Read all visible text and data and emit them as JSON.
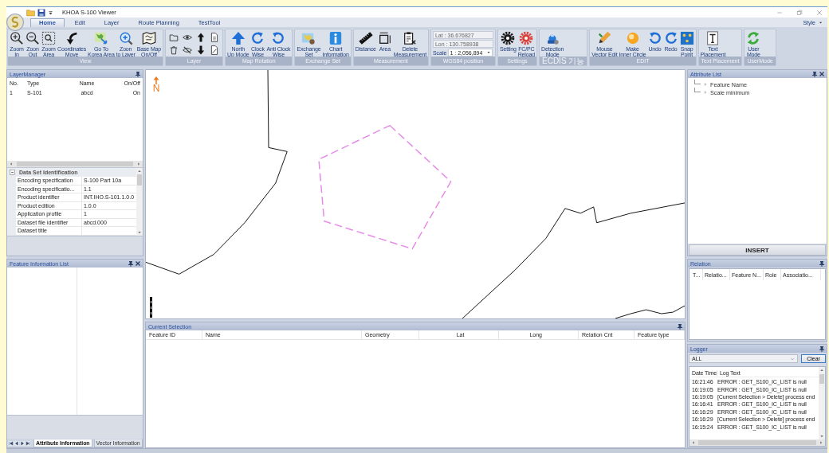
{
  "window": {
    "title": "KHOA S-100 Viewer",
    "style_menu": "Style"
  },
  "tabs": [
    {
      "label": "Home",
      "selected": true
    },
    {
      "label": "Edit",
      "selected": false
    },
    {
      "label": "Layer",
      "selected": false
    },
    {
      "label": "Route Planning",
      "selected": false
    },
    {
      "label": "TestTool",
      "selected": false
    }
  ],
  "ribbon": [
    {
      "label": "View",
      "kind": "buttons",
      "buttons": [
        "Zoom\nIn",
        "Zoon\nOut",
        "Zoom\nArea",
        "Coordinates\nMove",
        "Go To\nKorea Area",
        "Zoon\nto Layer",
        "Base Map\nOn/Off"
      ]
    },
    {
      "label": "Layer",
      "kind": "small_icons"
    },
    {
      "label": "Map Rotation",
      "kind": "buttons",
      "buttons": [
        "North\nUp Mode",
        "Clock\nWise",
        "Anti Clock\nWise"
      ]
    },
    {
      "label": "Exchange Set",
      "kind": "buttons",
      "buttons": [
        "Exchange\nSet",
        "Chart\nInformation"
      ]
    },
    {
      "label": "Measurement",
      "kind": "buttons",
      "buttons": [
        "Distance",
        "Area",
        "Delete\nMeasurement"
      ]
    },
    {
      "label": "WGS84 position",
      "kind": "position",
      "lat": "Lat : 36.676827",
      "lon": "Lon : 130.758938",
      "scale_label": "Scale",
      "scale": "1 : 2,056,894"
    },
    {
      "label": "Settings",
      "kind": "buttons",
      "buttons": [
        "Setting",
        "FC/PC\nReload"
      ]
    },
    {
      "label": "ECDIS 기능",
      "kind": "buttons",
      "buttons": [
        "Detection\nMode"
      ]
    },
    {
      "label": "EDIT",
      "kind": "buttons",
      "buttons": [
        "Mouse\nVector Edit",
        "Make\nInner Circle",
        "Undo",
        "Redo",
        "Snap\nPoint"
      ]
    },
    {
      "label": "Text Placement",
      "kind": "buttons",
      "buttons": [
        "Text\nPlacement"
      ]
    },
    {
      "label": "UserMode",
      "kind": "buttons",
      "buttons": [
        "User\nMode"
      ]
    }
  ],
  "layer_manager": {
    "title": "LayerManager",
    "columns": [
      "No.",
      "Type",
      "Name",
      "On/Off"
    ],
    "rows": [
      [
        "1",
        "S-101",
        "abcd",
        "On"
      ]
    ]
  },
  "dataset_properties": {
    "category": "Data Set Identification",
    "expanded": true,
    "rows": [
      [
        "Encoding specification",
        "S-100 Part 10a"
      ],
      [
        "Encoding specificatio...",
        "1.1"
      ],
      [
        "Product identifier",
        "INT.IHO.S-101.1.0.0"
      ],
      [
        "Product edition",
        "1.0.0"
      ],
      [
        "Application profile",
        "1"
      ],
      [
        "Dataset file identifier",
        "abcd.000"
      ],
      [
        "Dataset title",
        ""
      ]
    ]
  },
  "feature_info": {
    "title": "Feature Information List",
    "tabs": [
      {
        "label": "Attribute Information",
        "selected": true
      },
      {
        "label": "Vector Information",
        "selected": false
      }
    ]
  },
  "map": {
    "north_label": "N"
  },
  "current_selection": {
    "title": "Current Selection",
    "columns": [
      "Feature ID",
      "Name",
      "Geometry",
      "Lat",
      "Long",
      "Relation Cnt",
      "Feature type"
    ]
  },
  "attribute_list": {
    "title": "Attribute List",
    "items": [
      "Feature Name",
      "Scale minimum"
    ],
    "insert_button": "INSERT"
  },
  "relation": {
    "title": "Relation",
    "columns": [
      "T...",
      "Relatio...",
      "Feature N...",
      "Role",
      "Associatio..."
    ]
  },
  "logger": {
    "title": "Logger",
    "filter": "ALL",
    "clear_button": "Clear",
    "columns": [
      "Date Time",
      "Log Text"
    ],
    "rows": [
      [
        "16:21:46",
        "ERROR : GET_S100_IC_LIST is null"
      ],
      [
        "16:19:05",
        "ERROR : GET_S100_IC_LIST is null"
      ],
      [
        "16:19:05",
        "[Current Selection > Delete] process end"
      ],
      [
        "16:16:41",
        "ERROR : GET_S100_IC_LIST is null"
      ],
      [
        "16:16:29",
        "ERROR : GET_S100_IC_LIST is null"
      ],
      [
        "16:16:29",
        "[Current Selection > Delete] process end"
      ],
      [
        "16:15:24",
        "ERROR : GET_S100_IC_LIST is null"
      ]
    ]
  }
}
